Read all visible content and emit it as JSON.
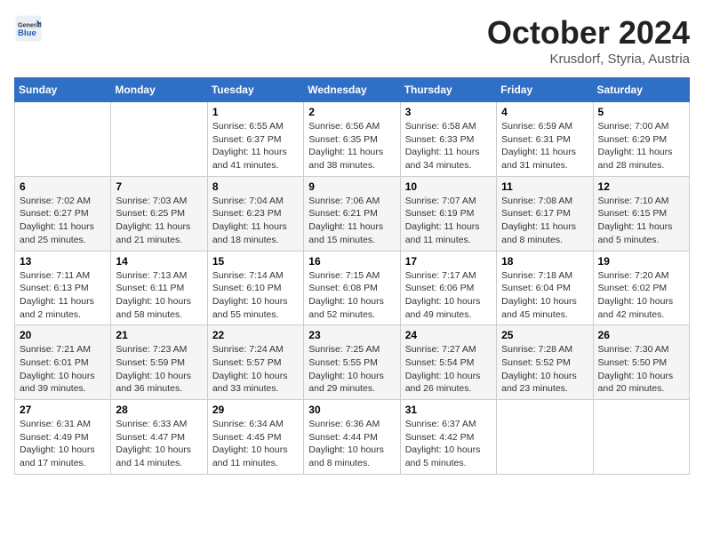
{
  "header": {
    "logo_general": "General",
    "logo_blue": "Blue",
    "month": "October 2024",
    "location": "Krusdorf, Styria, Austria"
  },
  "weekdays": [
    "Sunday",
    "Monday",
    "Tuesday",
    "Wednesday",
    "Thursday",
    "Friday",
    "Saturday"
  ],
  "weeks": [
    [
      {
        "day": "",
        "info": ""
      },
      {
        "day": "",
        "info": ""
      },
      {
        "day": "1",
        "info": "Sunrise: 6:55 AM\nSunset: 6:37 PM\nDaylight: 11 hours and 41 minutes."
      },
      {
        "day": "2",
        "info": "Sunrise: 6:56 AM\nSunset: 6:35 PM\nDaylight: 11 hours and 38 minutes."
      },
      {
        "day": "3",
        "info": "Sunrise: 6:58 AM\nSunset: 6:33 PM\nDaylight: 11 hours and 34 minutes."
      },
      {
        "day": "4",
        "info": "Sunrise: 6:59 AM\nSunset: 6:31 PM\nDaylight: 11 hours and 31 minutes."
      },
      {
        "day": "5",
        "info": "Sunrise: 7:00 AM\nSunset: 6:29 PM\nDaylight: 11 hours and 28 minutes."
      }
    ],
    [
      {
        "day": "6",
        "info": "Sunrise: 7:02 AM\nSunset: 6:27 PM\nDaylight: 11 hours and 25 minutes."
      },
      {
        "day": "7",
        "info": "Sunrise: 7:03 AM\nSunset: 6:25 PM\nDaylight: 11 hours and 21 minutes."
      },
      {
        "day": "8",
        "info": "Sunrise: 7:04 AM\nSunset: 6:23 PM\nDaylight: 11 hours and 18 minutes."
      },
      {
        "day": "9",
        "info": "Sunrise: 7:06 AM\nSunset: 6:21 PM\nDaylight: 11 hours and 15 minutes."
      },
      {
        "day": "10",
        "info": "Sunrise: 7:07 AM\nSunset: 6:19 PM\nDaylight: 11 hours and 11 minutes."
      },
      {
        "day": "11",
        "info": "Sunrise: 7:08 AM\nSunset: 6:17 PM\nDaylight: 11 hours and 8 minutes."
      },
      {
        "day": "12",
        "info": "Sunrise: 7:10 AM\nSunset: 6:15 PM\nDaylight: 11 hours and 5 minutes."
      }
    ],
    [
      {
        "day": "13",
        "info": "Sunrise: 7:11 AM\nSunset: 6:13 PM\nDaylight: 11 hours and 2 minutes."
      },
      {
        "day": "14",
        "info": "Sunrise: 7:13 AM\nSunset: 6:11 PM\nDaylight: 10 hours and 58 minutes."
      },
      {
        "day": "15",
        "info": "Sunrise: 7:14 AM\nSunset: 6:10 PM\nDaylight: 10 hours and 55 minutes."
      },
      {
        "day": "16",
        "info": "Sunrise: 7:15 AM\nSunset: 6:08 PM\nDaylight: 10 hours and 52 minutes."
      },
      {
        "day": "17",
        "info": "Sunrise: 7:17 AM\nSunset: 6:06 PM\nDaylight: 10 hours and 49 minutes."
      },
      {
        "day": "18",
        "info": "Sunrise: 7:18 AM\nSunset: 6:04 PM\nDaylight: 10 hours and 45 minutes."
      },
      {
        "day": "19",
        "info": "Sunrise: 7:20 AM\nSunset: 6:02 PM\nDaylight: 10 hours and 42 minutes."
      }
    ],
    [
      {
        "day": "20",
        "info": "Sunrise: 7:21 AM\nSunset: 6:01 PM\nDaylight: 10 hours and 39 minutes."
      },
      {
        "day": "21",
        "info": "Sunrise: 7:23 AM\nSunset: 5:59 PM\nDaylight: 10 hours and 36 minutes."
      },
      {
        "day": "22",
        "info": "Sunrise: 7:24 AM\nSunset: 5:57 PM\nDaylight: 10 hours and 33 minutes."
      },
      {
        "day": "23",
        "info": "Sunrise: 7:25 AM\nSunset: 5:55 PM\nDaylight: 10 hours and 29 minutes."
      },
      {
        "day": "24",
        "info": "Sunrise: 7:27 AM\nSunset: 5:54 PM\nDaylight: 10 hours and 26 minutes."
      },
      {
        "day": "25",
        "info": "Sunrise: 7:28 AM\nSunset: 5:52 PM\nDaylight: 10 hours and 23 minutes."
      },
      {
        "day": "26",
        "info": "Sunrise: 7:30 AM\nSunset: 5:50 PM\nDaylight: 10 hours and 20 minutes."
      }
    ],
    [
      {
        "day": "27",
        "info": "Sunrise: 6:31 AM\nSunset: 4:49 PM\nDaylight: 10 hours and 17 minutes."
      },
      {
        "day": "28",
        "info": "Sunrise: 6:33 AM\nSunset: 4:47 PM\nDaylight: 10 hours and 14 minutes."
      },
      {
        "day": "29",
        "info": "Sunrise: 6:34 AM\nSunset: 4:45 PM\nDaylight: 10 hours and 11 minutes."
      },
      {
        "day": "30",
        "info": "Sunrise: 6:36 AM\nSunset: 4:44 PM\nDaylight: 10 hours and 8 minutes."
      },
      {
        "day": "31",
        "info": "Sunrise: 6:37 AM\nSunset: 4:42 PM\nDaylight: 10 hours and 5 minutes."
      },
      {
        "day": "",
        "info": ""
      },
      {
        "day": "",
        "info": ""
      }
    ]
  ]
}
